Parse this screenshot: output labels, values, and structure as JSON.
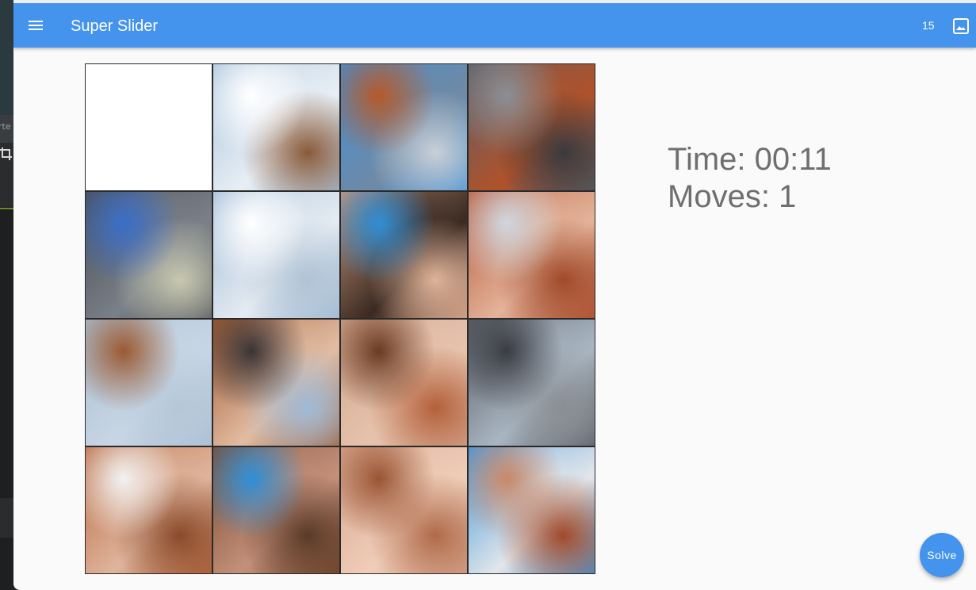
{
  "app": {
    "title": "Super Slider",
    "puzzle_count": "15",
    "menu_icon": "menu-icon",
    "image_icon": "image-icon",
    "accent_color": "#4493ed"
  },
  "background": {
    "strip_text": "rte"
  },
  "stats": {
    "time_text": "Time: 00:11",
    "moves_text": "Moves: 1"
  },
  "fab": {
    "label": "Solve"
  },
  "board": {
    "grid": "4x4",
    "tiles": [
      {
        "kind": "empty"
      },
      {
        "kind": "sky-clouds",
        "colors": [
          "#a9c4df",
          "#e8eef4",
          "#ffffff",
          "#8a5a3a"
        ]
      },
      {
        "kind": "blue-shirt-feathers",
        "colors": [
          "#3f8fd6",
          "#6f8aa6",
          "#b55a2a",
          "#c8d0d8"
        ]
      },
      {
        "kind": "parrot-hair",
        "colors": [
          "#5c6068",
          "#b0522a",
          "#8a8f96",
          "#3a3a3e"
        ]
      },
      {
        "kind": "parrot-head",
        "colors": [
          "#4a4e55",
          "#7a8088",
          "#3a6ec8",
          "#c8c8b0"
        ]
      },
      {
        "kind": "clouds",
        "colors": [
          "#9fbad6",
          "#e4ebf2",
          "#ffffff",
          "#b0c2d4"
        ]
      },
      {
        "kind": "face-shirt",
        "colors": [
          "#c9977a",
          "#3a2a22",
          "#2f8fd6",
          "#e0b49a"
        ]
      },
      {
        "kind": "face-hair",
        "colors": [
          "#b8593a",
          "#e3b39a",
          "#cfd6de",
          "#a04a2a"
        ]
      },
      {
        "kind": "sky-hair",
        "colors": [
          "#a9bfd4",
          "#c8d6e4",
          "#9a5a32",
          "#b6c7d8"
        ]
      },
      {
        "kind": "face-glasses",
        "colors": [
          "#a05a32",
          "#e2bca2",
          "#3a3436",
          "#9fbad6"
        ]
      },
      {
        "kind": "face-smile",
        "colors": [
          "#d4a890",
          "#e6c2ac",
          "#6a3a22",
          "#b4603a"
        ]
      },
      {
        "kind": "parrot-wing",
        "colors": [
          "#5a5e66",
          "#a9b6c2",
          "#3a3c42",
          "#8a8e94"
        ]
      },
      {
        "kind": "freckles-eye",
        "colors": [
          "#b8683e",
          "#dfb49c",
          "#f2f2f2",
          "#8a4a2a"
        ]
      },
      {
        "kind": "chin-shirt",
        "colors": [
          "#7a4a2e",
          "#c4907a",
          "#2f8fd6",
          "#5a3a28"
        ]
      },
      {
        "kind": "smile-teeth",
        "colors": [
          "#d8a68e",
          "#efcdb8",
          "#9a5434",
          "#b06a4a"
        ]
      },
      {
        "kind": "parrot-shirt",
        "colors": [
          "#3f96dc",
          "#e2e6ea",
          "#c8896a",
          "#a04a2a"
        ]
      }
    ]
  }
}
